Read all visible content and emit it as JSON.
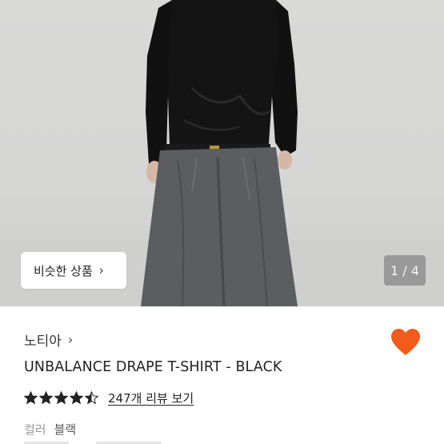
{
  "gallery": {
    "similar_products_label": "비슷한 상품",
    "chevron_glyph": "›",
    "counter": "1 / 4",
    "current_image": 1,
    "total_images": 4
  },
  "product": {
    "brand": "노티아",
    "brand_chevron": "›",
    "title": "UNBALANCE DRAPE T-SHIRT - BLACK",
    "favorite": true,
    "rating": 4.5,
    "review_link": "247개 리뷰 보기",
    "option_label": "컬러",
    "option_value": "블랙"
  },
  "colors": {
    "heart": "#f25c1a",
    "star": "#222222",
    "background": "#ffffff",
    "photo_background": "#d8d8d7"
  },
  "icons": {
    "heart": "heart-icon",
    "star": "star-icon",
    "chevron": "chevron-right-icon"
  }
}
